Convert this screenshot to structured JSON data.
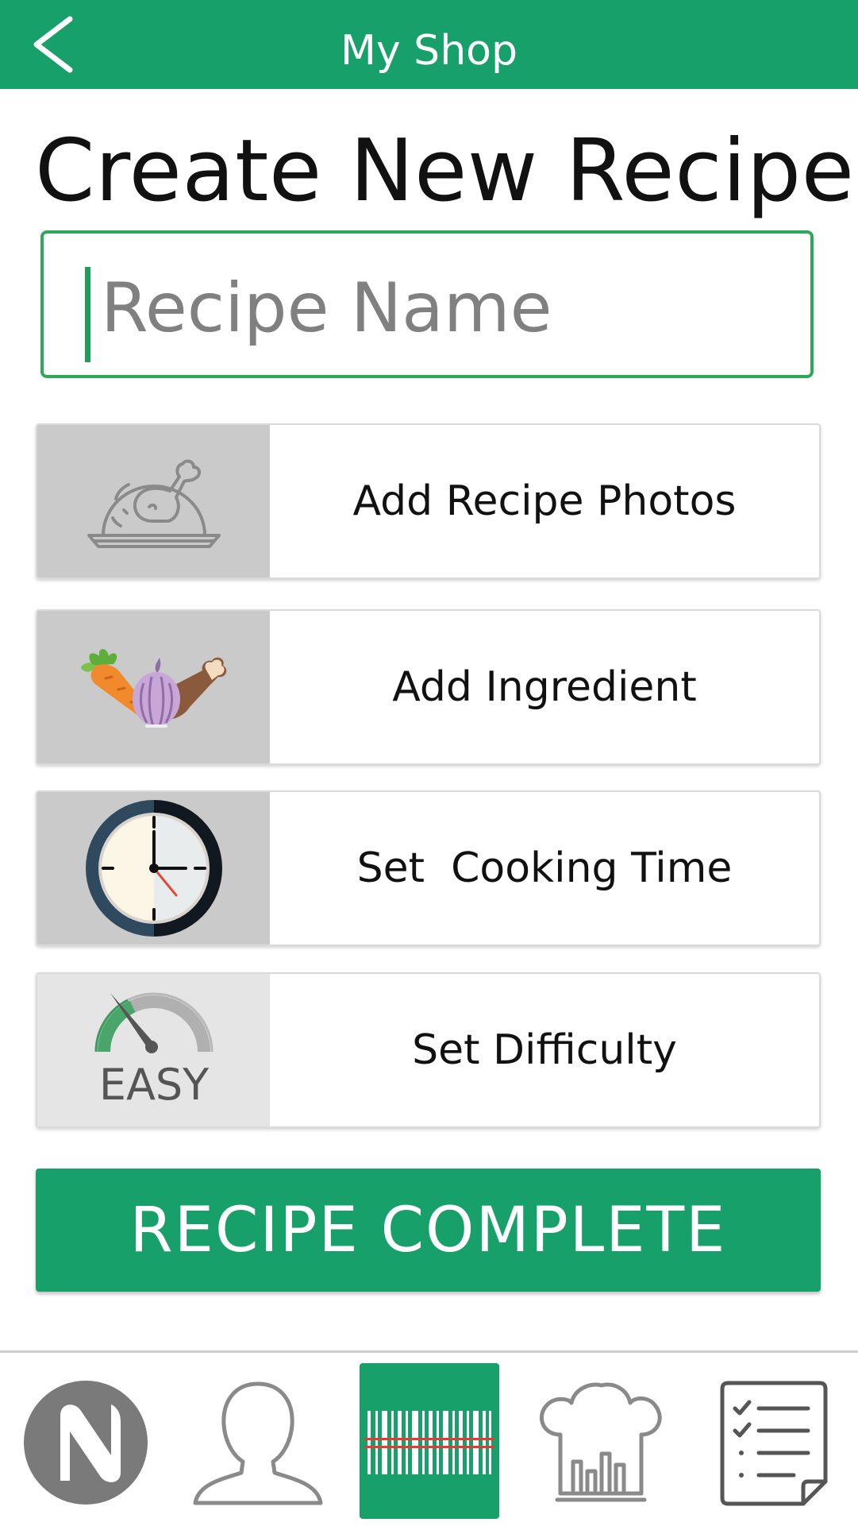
{
  "header": {
    "title": "My Shop",
    "back_icon": "chevron-left-icon"
  },
  "page": {
    "title": "Create New Recipe"
  },
  "recipe_name": {
    "placeholder": "Recipe Name",
    "value": ""
  },
  "actions": [
    {
      "label": "Add Recipe Photos",
      "icon": "roast-chicken-icon"
    },
    {
      "label": "Add Ingredient",
      "icon": "ingredients-icon"
    },
    {
      "label": "Set  Cooking Time",
      "icon": "clock-icon"
    },
    {
      "label": "Set Difficulty",
      "icon": "difficulty-gauge-icon",
      "icon_text": "EASY"
    }
  ],
  "complete_button": {
    "label": "RECIPE COMPLETE"
  },
  "bottom_nav": {
    "items": [
      {
        "icon": "app-logo-icon"
      },
      {
        "icon": "profile-icon"
      },
      {
        "icon": "barcode-scan-icon",
        "active": true
      },
      {
        "icon": "chef-hat-chart-icon"
      },
      {
        "icon": "checklist-icon"
      }
    ]
  },
  "colors": {
    "brand_green": "#18a06a",
    "input_border": "#2ea95c",
    "icon_box_bg": "#cacaca",
    "text_dark": "#111111",
    "placeholder_grey": "#808080"
  }
}
